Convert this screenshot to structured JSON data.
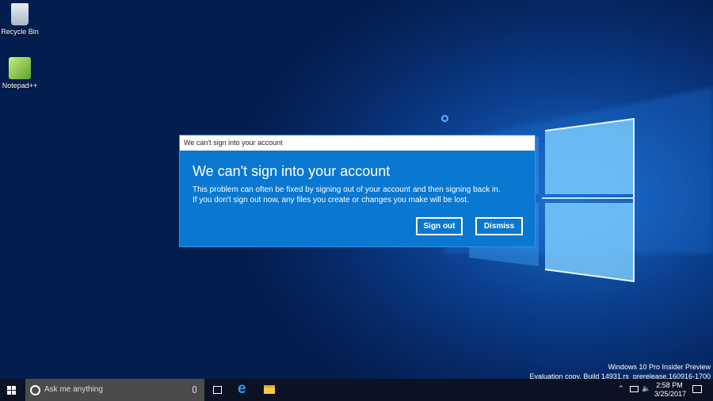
{
  "desktop": {
    "icons": [
      {
        "label": "Recycle Bin"
      },
      {
        "label": "Notepad++"
      }
    ]
  },
  "dialog": {
    "title": "We can't sign into your account",
    "heading": "We can't sign into your account",
    "body_line1": "This problem can often be fixed by signing out of your account and then signing back in.",
    "body_line2": "If you don't sign out now, any files you create or changes you make will be lost.",
    "sign_out_label": "Sign out",
    "dismiss_label": "Dismiss"
  },
  "watermark": {
    "line1": "Windows 10 Pro Insider Preview",
    "line2": "Evaluation copy. Build 14931.rs_prerelease.160916-1700"
  },
  "taskbar": {
    "search_placeholder": "Ask me anything",
    "time": "2:58 PM",
    "date": "3/25/2017"
  }
}
